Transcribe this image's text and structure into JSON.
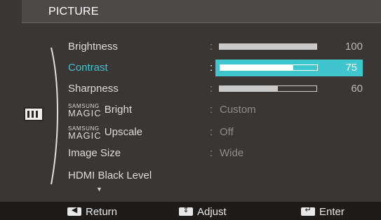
{
  "header": {
    "title": "PICTURE"
  },
  "menu": {
    "brightness": {
      "label": "Brightness",
      "value": "100",
      "level": 1.0
    },
    "contrast": {
      "label": "Contrast",
      "value": "75",
      "level": 0.75
    },
    "sharpness": {
      "label": "Sharpness",
      "value": "60",
      "level": 0.6
    },
    "magic_bright": {
      "brand": "SAMSUNG",
      "magic": "MAGIC",
      "label": "Bright",
      "value": "Custom"
    },
    "magic_upscale": {
      "brand": "SAMSUNG",
      "magic": "MAGIC",
      "label": "Upscale",
      "value": "Off"
    },
    "image_size": {
      "label": "Image Size",
      "value": "Wide"
    },
    "hdmi_black_level": {
      "label": "HDMI Black Level"
    },
    "separator": ":",
    "scroll_down": "▼"
  },
  "footer": {
    "return_label": "Return",
    "adjust_label": "Adjust",
    "enter_label": "Enter",
    "return_key": "◀",
    "adjust_key": "⇕",
    "enter_key": "↵"
  },
  "colors": {
    "accent": "#3ec5cd",
    "background": "#3a3634",
    "footer": "#1e1c1b"
  }
}
